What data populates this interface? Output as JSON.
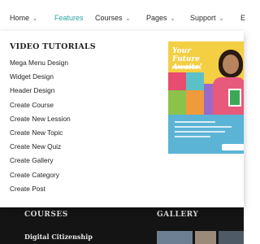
{
  "nav": {
    "home": "Home",
    "features": "Features",
    "courses": "Courses",
    "pages": "Pages",
    "support": "Support",
    "extra": "E"
  },
  "mega_menu": {
    "heading": "VIDEO TUTORIALS",
    "items": [
      "Mega Menu Design",
      "Widget Design",
      "Header Design",
      "Create Course",
      "Create New Lession",
      "Create New Topic",
      "Create New Quiz",
      "Create Gallery",
      "Create Category",
      "Create Post"
    ],
    "promo": {
      "title": "Your Future Awaits!"
    }
  },
  "footer": {
    "courses_heading": "COURSES",
    "gallery_heading": "GALLERY",
    "link": "Digital Citizenship"
  },
  "colors": {
    "accent": "#2aa4a0",
    "promo_yellow": "#f4cf44",
    "promo_blue": "#5bb4d6",
    "footer_bg": "#141414"
  }
}
